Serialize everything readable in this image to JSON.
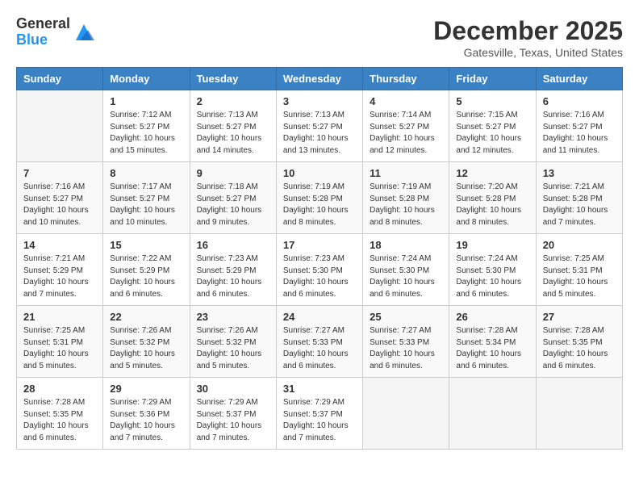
{
  "header": {
    "logo_general": "General",
    "logo_blue": "Blue",
    "month_title": "December 2025",
    "location": "Gatesville, Texas, United States"
  },
  "weekdays": [
    "Sunday",
    "Monday",
    "Tuesday",
    "Wednesday",
    "Thursday",
    "Friday",
    "Saturday"
  ],
  "weeks": [
    [
      {
        "day": "",
        "info": ""
      },
      {
        "day": "1",
        "info": "Sunrise: 7:12 AM\nSunset: 5:27 PM\nDaylight: 10 hours\nand 15 minutes."
      },
      {
        "day": "2",
        "info": "Sunrise: 7:13 AM\nSunset: 5:27 PM\nDaylight: 10 hours\nand 14 minutes."
      },
      {
        "day": "3",
        "info": "Sunrise: 7:13 AM\nSunset: 5:27 PM\nDaylight: 10 hours\nand 13 minutes."
      },
      {
        "day": "4",
        "info": "Sunrise: 7:14 AM\nSunset: 5:27 PM\nDaylight: 10 hours\nand 12 minutes."
      },
      {
        "day": "5",
        "info": "Sunrise: 7:15 AM\nSunset: 5:27 PM\nDaylight: 10 hours\nand 12 minutes."
      },
      {
        "day": "6",
        "info": "Sunrise: 7:16 AM\nSunset: 5:27 PM\nDaylight: 10 hours\nand 11 minutes."
      }
    ],
    [
      {
        "day": "7",
        "info": "Sunrise: 7:16 AM\nSunset: 5:27 PM\nDaylight: 10 hours\nand 10 minutes."
      },
      {
        "day": "8",
        "info": "Sunrise: 7:17 AM\nSunset: 5:27 PM\nDaylight: 10 hours\nand 10 minutes."
      },
      {
        "day": "9",
        "info": "Sunrise: 7:18 AM\nSunset: 5:27 PM\nDaylight: 10 hours\nand 9 minutes."
      },
      {
        "day": "10",
        "info": "Sunrise: 7:19 AM\nSunset: 5:28 PM\nDaylight: 10 hours\nand 8 minutes."
      },
      {
        "day": "11",
        "info": "Sunrise: 7:19 AM\nSunset: 5:28 PM\nDaylight: 10 hours\nand 8 minutes."
      },
      {
        "day": "12",
        "info": "Sunrise: 7:20 AM\nSunset: 5:28 PM\nDaylight: 10 hours\nand 8 minutes."
      },
      {
        "day": "13",
        "info": "Sunrise: 7:21 AM\nSunset: 5:28 PM\nDaylight: 10 hours\nand 7 minutes."
      }
    ],
    [
      {
        "day": "14",
        "info": "Sunrise: 7:21 AM\nSunset: 5:29 PM\nDaylight: 10 hours\nand 7 minutes."
      },
      {
        "day": "15",
        "info": "Sunrise: 7:22 AM\nSunset: 5:29 PM\nDaylight: 10 hours\nand 6 minutes."
      },
      {
        "day": "16",
        "info": "Sunrise: 7:23 AM\nSunset: 5:29 PM\nDaylight: 10 hours\nand 6 minutes."
      },
      {
        "day": "17",
        "info": "Sunrise: 7:23 AM\nSunset: 5:30 PM\nDaylight: 10 hours\nand 6 minutes."
      },
      {
        "day": "18",
        "info": "Sunrise: 7:24 AM\nSunset: 5:30 PM\nDaylight: 10 hours\nand 6 minutes."
      },
      {
        "day": "19",
        "info": "Sunrise: 7:24 AM\nSunset: 5:30 PM\nDaylight: 10 hours\nand 6 minutes."
      },
      {
        "day": "20",
        "info": "Sunrise: 7:25 AM\nSunset: 5:31 PM\nDaylight: 10 hours\nand 5 minutes."
      }
    ],
    [
      {
        "day": "21",
        "info": "Sunrise: 7:25 AM\nSunset: 5:31 PM\nDaylight: 10 hours\nand 5 minutes."
      },
      {
        "day": "22",
        "info": "Sunrise: 7:26 AM\nSunset: 5:32 PM\nDaylight: 10 hours\nand 5 minutes."
      },
      {
        "day": "23",
        "info": "Sunrise: 7:26 AM\nSunset: 5:32 PM\nDaylight: 10 hours\nand 5 minutes."
      },
      {
        "day": "24",
        "info": "Sunrise: 7:27 AM\nSunset: 5:33 PM\nDaylight: 10 hours\nand 6 minutes."
      },
      {
        "day": "25",
        "info": "Sunrise: 7:27 AM\nSunset: 5:33 PM\nDaylight: 10 hours\nand 6 minutes."
      },
      {
        "day": "26",
        "info": "Sunrise: 7:28 AM\nSunset: 5:34 PM\nDaylight: 10 hours\nand 6 minutes."
      },
      {
        "day": "27",
        "info": "Sunrise: 7:28 AM\nSunset: 5:35 PM\nDaylight: 10 hours\nand 6 minutes."
      }
    ],
    [
      {
        "day": "28",
        "info": "Sunrise: 7:28 AM\nSunset: 5:35 PM\nDaylight: 10 hours\nand 6 minutes."
      },
      {
        "day": "29",
        "info": "Sunrise: 7:29 AM\nSunset: 5:36 PM\nDaylight: 10 hours\nand 7 minutes."
      },
      {
        "day": "30",
        "info": "Sunrise: 7:29 AM\nSunset: 5:37 PM\nDaylight: 10 hours\nand 7 minutes."
      },
      {
        "day": "31",
        "info": "Sunrise: 7:29 AM\nSunset: 5:37 PM\nDaylight: 10 hours\nand 7 minutes."
      },
      {
        "day": "",
        "info": ""
      },
      {
        "day": "",
        "info": ""
      },
      {
        "day": "",
        "info": ""
      }
    ]
  ]
}
